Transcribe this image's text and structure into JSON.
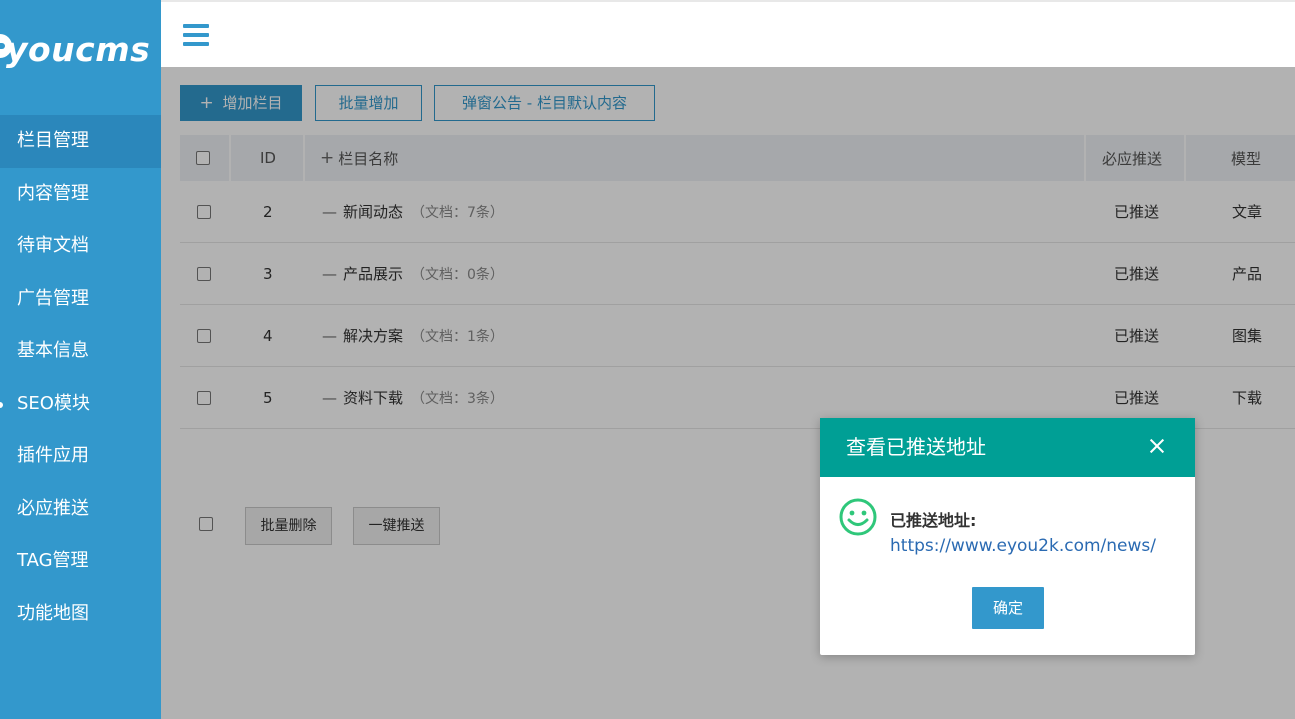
{
  "brand": {
    "logo_text": "youcms"
  },
  "sidebar": {
    "items": [
      {
        "label": "栏目管理",
        "active": true
      },
      {
        "label": "内容管理"
      },
      {
        "label": "待审文档"
      },
      {
        "label": "广告管理"
      },
      {
        "label": "基本信息"
      },
      {
        "label": "SEO模块"
      },
      {
        "label": "插件应用"
      },
      {
        "label": "必应推送"
      },
      {
        "label": "TAG管理"
      },
      {
        "label": "功能地图"
      }
    ]
  },
  "toolbar": {
    "add_column": "增加栏目",
    "add_icon": "plus-icon",
    "batch_add": "批量增加",
    "popup_notice": "弹窗公告 - 栏目默认内容"
  },
  "table": {
    "headers": {
      "id": "ID",
      "name": "栏目名称",
      "bing_push": "必应推送",
      "model": "模型"
    },
    "rows": [
      {
        "id": "2",
        "name": "新闻动态",
        "docs": "（文档：7条）",
        "push": "已推送",
        "model": "文章"
      },
      {
        "id": "3",
        "name": "产品展示",
        "docs": "（文档：0条）",
        "push": "已推送",
        "model": "产品"
      },
      {
        "id": "4",
        "name": "解决方案",
        "docs": "（文档：1条）",
        "push": "已推送",
        "model": "图集"
      },
      {
        "id": "5",
        "name": "资料下载",
        "docs": "（文档：3条）",
        "push": "已推送",
        "model": "下载"
      }
    ],
    "row_prefix": "—",
    "header_prefix": "+"
  },
  "footer": {
    "batch_delete": "批量删除",
    "one_click_push": "一键推送"
  },
  "modal": {
    "title": "查看已推送地址",
    "label": "已推送地址:",
    "url": "https://www.eyou2k.com/news/",
    "ok": "确定",
    "icon": "smile-icon",
    "colors": {
      "header": "#009f95",
      "icon": "#2fc77a"
    }
  },
  "colors": {
    "primary": "#3398cc",
    "sidebar_active": "#2b87bb"
  }
}
